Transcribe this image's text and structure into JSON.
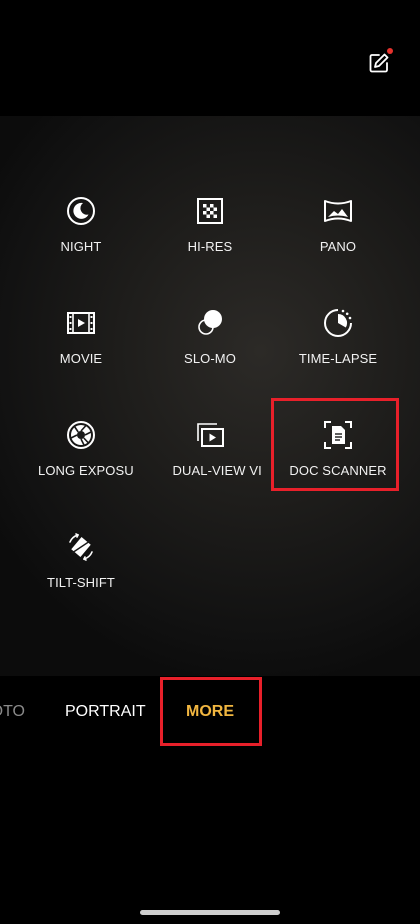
{
  "header": {
    "edit_icon": "edit-pencil-icon",
    "has_notification": true
  },
  "modes": [
    {
      "id": "night",
      "label": "NIGHT",
      "icon": "night-moon-icon"
    },
    {
      "id": "hi-res",
      "label": "HI-RES",
      "icon": "hi-res-grid-icon"
    },
    {
      "id": "pano",
      "label": "PANO",
      "icon": "panorama-icon"
    },
    {
      "id": "movie",
      "label": "MOVIE",
      "icon": "movie-film-icon"
    },
    {
      "id": "slo-mo",
      "label": "SLO-MO",
      "icon": "slow-motion-icon"
    },
    {
      "id": "time-lapse",
      "label": "TIME-LAPSE",
      "icon": "time-lapse-icon"
    },
    {
      "id": "long-exposure",
      "label": "LONG EXPOSURE",
      "icon": "aperture-icon"
    },
    {
      "id": "dual-view",
      "label": "DUAL-VIEW VIDEO",
      "icon": "dual-view-icon"
    },
    {
      "id": "doc-scanner",
      "label": "DOC SCANNER",
      "icon": "document-scan-icon"
    },
    {
      "id": "tilt-shift",
      "label": "TILT-SHIFT",
      "icon": "tilt-shift-icon"
    }
  ],
  "mode_bar": {
    "tabs": [
      {
        "label": "PHOTO",
        "state": "partial"
      },
      {
        "label": "PORTRAIT",
        "state": "inactive"
      },
      {
        "label": "MORE",
        "state": "active"
      }
    ],
    "active_color": "#f1b640"
  },
  "highlight_color": "#e8202a"
}
